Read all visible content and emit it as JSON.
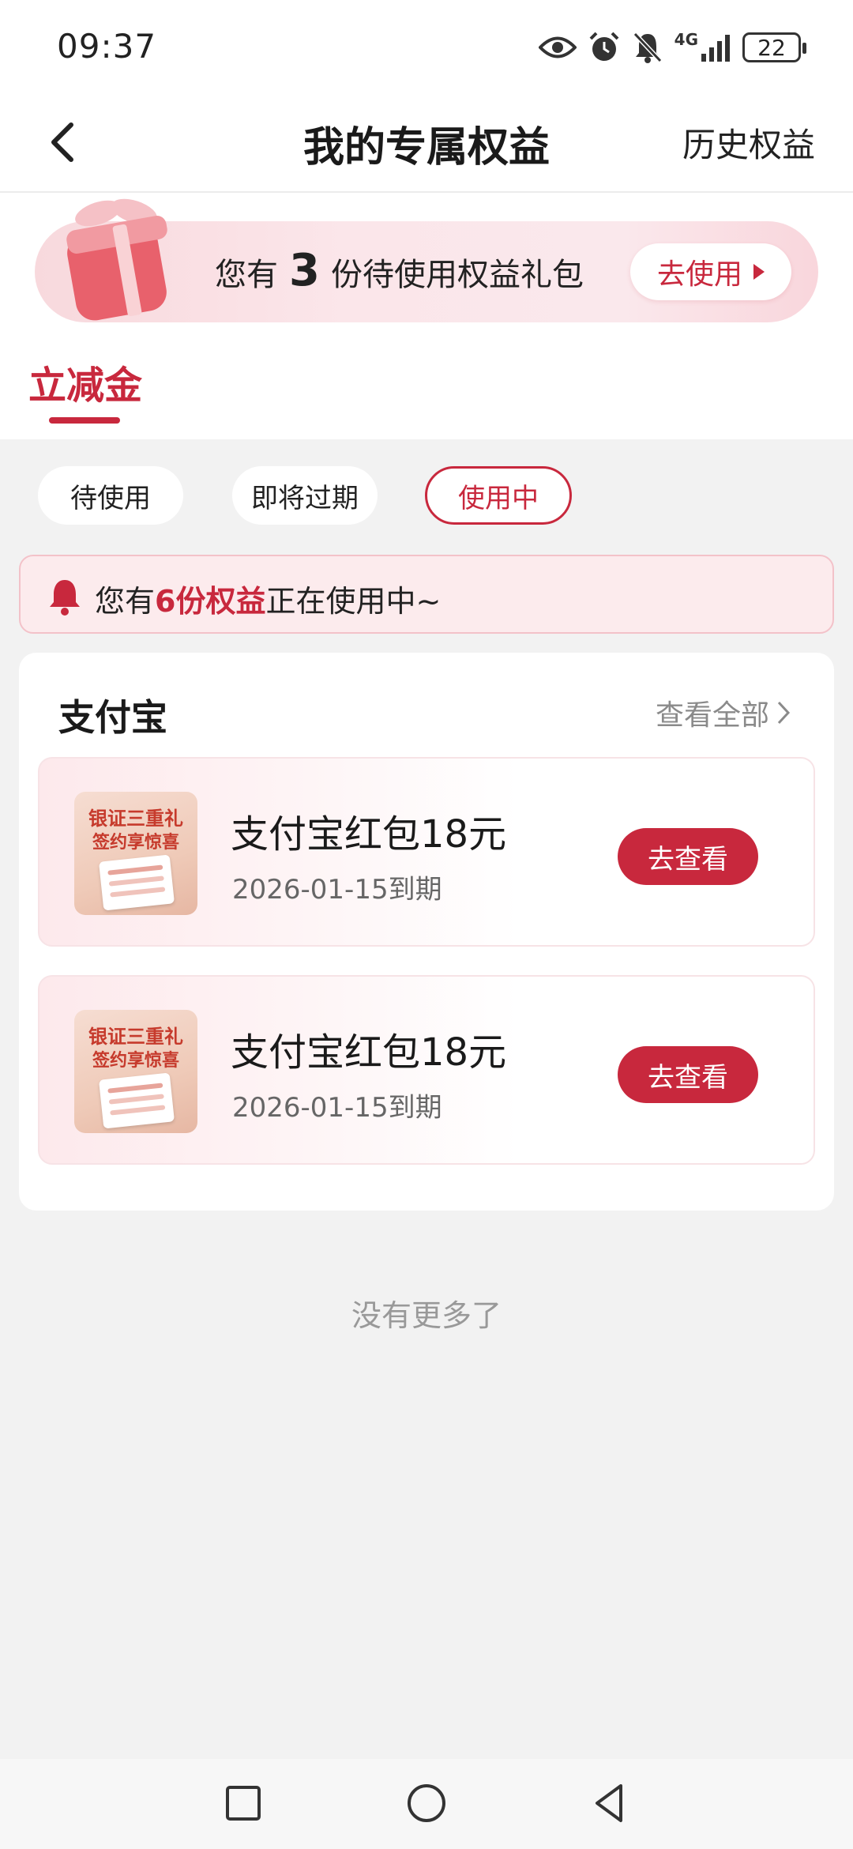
{
  "status_bar": {
    "time": "09:37",
    "network": "4G",
    "battery": "22"
  },
  "header": {
    "title": "我的专属权益",
    "history_link": "历史权益"
  },
  "banner": {
    "prefix": "您有",
    "count": "3",
    "suffix": "份待使用权益礼包",
    "button": "去使用"
  },
  "main_tab": {
    "label": "立减金"
  },
  "filters": [
    {
      "label": "待使用",
      "active": false
    },
    {
      "label": "即将过期",
      "active": false
    },
    {
      "label": "使用中",
      "active": true
    }
  ],
  "notice": {
    "prefix": "您有",
    "highlight": "6份权益",
    "suffix": "正在使用中~"
  },
  "section": {
    "title": "支付宝",
    "view_all": "查看全部"
  },
  "items": [
    {
      "name": "支付宝红包18元",
      "expiry": "2026-01-15到期",
      "button": "去查看",
      "thumb_line1": "银证三重礼",
      "thumb_line2": "签约享惊喜"
    },
    {
      "name": "支付宝红包18元",
      "expiry": "2026-01-15到期",
      "button": "去查看",
      "thumb_line1": "银证三重礼",
      "thumb_line2": "签约享惊喜"
    }
  ],
  "footer": {
    "no_more": "没有更多了"
  },
  "colors": {
    "accent": "#c8283d",
    "background": "#f2f2f2"
  }
}
